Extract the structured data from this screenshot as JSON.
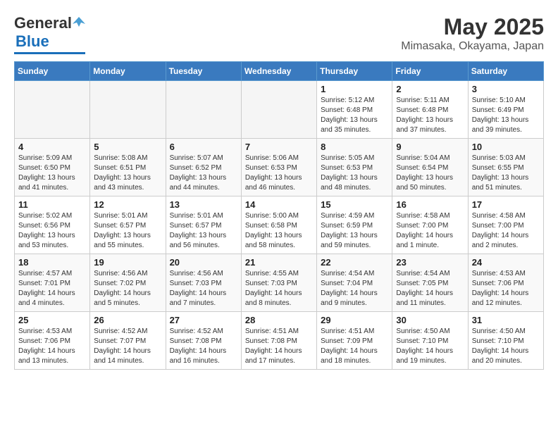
{
  "header": {
    "logo_general": "General",
    "logo_blue": "Blue",
    "month_title": "May 2025",
    "location": "Mimasaka, Okayama, Japan"
  },
  "days_of_week": [
    "Sunday",
    "Monday",
    "Tuesday",
    "Wednesday",
    "Thursday",
    "Friday",
    "Saturday"
  ],
  "weeks": [
    [
      {
        "day": "",
        "empty": true
      },
      {
        "day": "",
        "empty": true
      },
      {
        "day": "",
        "empty": true
      },
      {
        "day": "",
        "empty": true
      },
      {
        "day": "1",
        "sunrise": "5:12 AM",
        "sunset": "6:48 PM",
        "daylight": "13 hours and 35 minutes."
      },
      {
        "day": "2",
        "sunrise": "5:11 AM",
        "sunset": "6:48 PM",
        "daylight": "13 hours and 37 minutes."
      },
      {
        "day": "3",
        "sunrise": "5:10 AM",
        "sunset": "6:49 PM",
        "daylight": "13 hours and 39 minutes."
      }
    ],
    [
      {
        "day": "4",
        "sunrise": "5:09 AM",
        "sunset": "6:50 PM",
        "daylight": "13 hours and 41 minutes."
      },
      {
        "day": "5",
        "sunrise": "5:08 AM",
        "sunset": "6:51 PM",
        "daylight": "13 hours and 43 minutes."
      },
      {
        "day": "6",
        "sunrise": "5:07 AM",
        "sunset": "6:52 PM",
        "daylight": "13 hours and 44 minutes."
      },
      {
        "day": "7",
        "sunrise": "5:06 AM",
        "sunset": "6:53 PM",
        "daylight": "13 hours and 46 minutes."
      },
      {
        "day": "8",
        "sunrise": "5:05 AM",
        "sunset": "6:53 PM",
        "daylight": "13 hours and 48 minutes."
      },
      {
        "day": "9",
        "sunrise": "5:04 AM",
        "sunset": "6:54 PM",
        "daylight": "13 hours and 50 minutes."
      },
      {
        "day": "10",
        "sunrise": "5:03 AM",
        "sunset": "6:55 PM",
        "daylight": "13 hours and 51 minutes."
      }
    ],
    [
      {
        "day": "11",
        "sunrise": "5:02 AM",
        "sunset": "6:56 PM",
        "daylight": "13 hours and 53 minutes."
      },
      {
        "day": "12",
        "sunrise": "5:01 AM",
        "sunset": "6:57 PM",
        "daylight": "13 hours and 55 minutes."
      },
      {
        "day": "13",
        "sunrise": "5:01 AM",
        "sunset": "6:57 PM",
        "daylight": "13 hours and 56 minutes."
      },
      {
        "day": "14",
        "sunrise": "5:00 AM",
        "sunset": "6:58 PM",
        "daylight": "13 hours and 58 minutes."
      },
      {
        "day": "15",
        "sunrise": "4:59 AM",
        "sunset": "6:59 PM",
        "daylight": "13 hours and 59 minutes."
      },
      {
        "day": "16",
        "sunrise": "4:58 AM",
        "sunset": "7:00 PM",
        "daylight": "14 hours and 1 minute."
      },
      {
        "day": "17",
        "sunrise": "4:58 AM",
        "sunset": "7:00 PM",
        "daylight": "14 hours and 2 minutes."
      }
    ],
    [
      {
        "day": "18",
        "sunrise": "4:57 AM",
        "sunset": "7:01 PM",
        "daylight": "14 hours and 4 minutes."
      },
      {
        "day": "19",
        "sunrise": "4:56 AM",
        "sunset": "7:02 PM",
        "daylight": "14 hours and 5 minutes."
      },
      {
        "day": "20",
        "sunrise": "4:56 AM",
        "sunset": "7:03 PM",
        "daylight": "14 hours and 7 minutes."
      },
      {
        "day": "21",
        "sunrise": "4:55 AM",
        "sunset": "7:03 PM",
        "daylight": "14 hours and 8 minutes."
      },
      {
        "day": "22",
        "sunrise": "4:54 AM",
        "sunset": "7:04 PM",
        "daylight": "14 hours and 9 minutes."
      },
      {
        "day": "23",
        "sunrise": "4:54 AM",
        "sunset": "7:05 PM",
        "daylight": "14 hours and 11 minutes."
      },
      {
        "day": "24",
        "sunrise": "4:53 AM",
        "sunset": "7:06 PM",
        "daylight": "14 hours and 12 minutes."
      }
    ],
    [
      {
        "day": "25",
        "sunrise": "4:53 AM",
        "sunset": "7:06 PM",
        "daylight": "14 hours and 13 minutes."
      },
      {
        "day": "26",
        "sunrise": "4:52 AM",
        "sunset": "7:07 PM",
        "daylight": "14 hours and 14 minutes."
      },
      {
        "day": "27",
        "sunrise": "4:52 AM",
        "sunset": "7:08 PM",
        "daylight": "14 hours and 16 minutes."
      },
      {
        "day": "28",
        "sunrise": "4:51 AM",
        "sunset": "7:08 PM",
        "daylight": "14 hours and 17 minutes."
      },
      {
        "day": "29",
        "sunrise": "4:51 AM",
        "sunset": "7:09 PM",
        "daylight": "14 hours and 18 minutes."
      },
      {
        "day": "30",
        "sunrise": "4:50 AM",
        "sunset": "7:10 PM",
        "daylight": "14 hours and 19 minutes."
      },
      {
        "day": "31",
        "sunrise": "4:50 AM",
        "sunset": "7:10 PM",
        "daylight": "14 hours and 20 minutes."
      }
    ]
  ]
}
